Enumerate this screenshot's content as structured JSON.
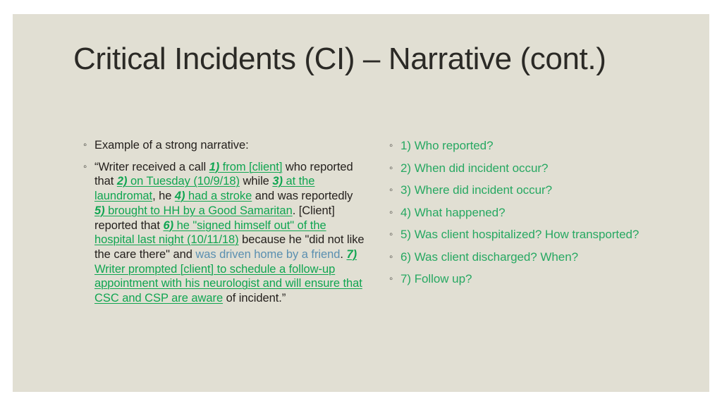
{
  "slide": {
    "background_color": "#e1dfd3",
    "page_background_color": "#ffffff",
    "title": "Critical Incidents (CI) – Narrative (cont.)"
  },
  "colors": {
    "title_text": "#2b2a26",
    "body_text": "#231f1c",
    "highlight_green": "#10a551",
    "accent_blue": "#5a8fb0",
    "bullet_marker": "#3b3a35",
    "right_list_text": "#27a862"
  },
  "left_column": {
    "lead_label": "Example of a strong narrative:",
    "narrative_full_text": "“Writer received a call 1) from [client] who reported that 2) on Tuesday (10/9/18) while 3) at the laundromat, he 4) had a stroke and was reportedly 5) brought to HH by a Good Samaritan. [Client] reported that 6) he \"signed himself out\" of the hospital last night (10/11/18) because he \"did not like the care there\" and was driven home by a friend. 7) Writer prompted [client] to schedule a follow-up appointment with his neurologist and will ensure that CSC and CSP are aware of incident.”",
    "runs": [
      {
        "text": "“Writer received a call ",
        "style": "plain"
      },
      {
        "text": "1)",
        "style": "green-marker"
      },
      {
        "text": " from [client]",
        "style": "green"
      },
      {
        "text": " who reported that ",
        "style": "plain"
      },
      {
        "text": "2)",
        "style": "green-marker"
      },
      {
        "text": " on Tuesday (10/9/18)",
        "style": "green"
      },
      {
        "text": " while ",
        "style": "plain"
      },
      {
        "text": "3)",
        "style": "green-marker"
      },
      {
        "text": " at the laundromat",
        "style": "green"
      },
      {
        "text": ", he ",
        "style": "plain"
      },
      {
        "text": "4)",
        "style": "green-marker"
      },
      {
        "text": " had a stroke",
        "style": "green"
      },
      {
        "text": " and was reportedly ",
        "style": "plain"
      },
      {
        "text": "5)",
        "style": "green-marker"
      },
      {
        "text": " brought to HH by a Good Samaritan",
        "style": "green"
      },
      {
        "text": ". [Client] reported that ",
        "style": "plain"
      },
      {
        "text": "6)",
        "style": "green-marker"
      },
      {
        "text": " he \"signed himself out\" of the hospital last night (10/11/18)",
        "style": "green"
      },
      {
        "text": " because he \"did not like the care there\" and ",
        "style": "plain"
      },
      {
        "text": "was driven home by a friend",
        "style": "blue"
      },
      {
        "text": ". ",
        "style": "plain"
      },
      {
        "text": "7)",
        "style": "green-marker"
      },
      {
        "text": " Writer prompted [client] to schedule a follow-up appointment with his neurologist and will ensure that CSC and CSP are aware",
        "style": "green"
      },
      {
        "text": " of incident.”",
        "style": "plain"
      }
    ]
  },
  "right_column": {
    "items": [
      {
        "label": "1) Who reported?"
      },
      {
        "label": "2) When did incident occur?"
      },
      {
        "label": "3) Where did incident occur?"
      },
      {
        "label": "4) What happened?"
      },
      {
        "label": "5) Was client hospitalized? How transported?"
      },
      {
        "label": "6) Was client discharged? When?"
      },
      {
        "label": "7) Follow up?"
      }
    ]
  }
}
